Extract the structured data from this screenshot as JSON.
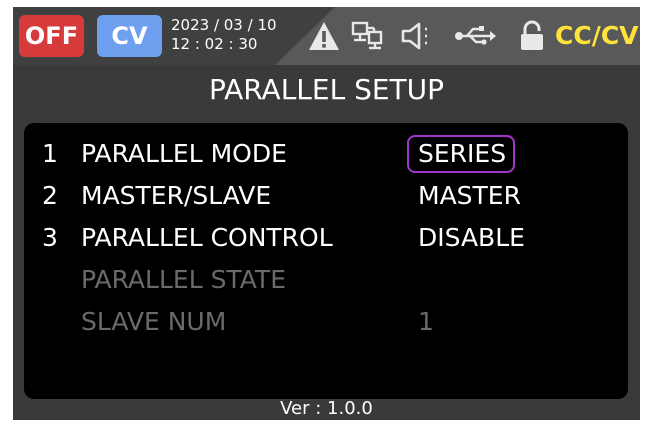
{
  "status": {
    "output_state": "OFF",
    "output_state_color": "#d63a3a",
    "regulation_mode": "CV",
    "regulation_mode_color": "#6fa0f0",
    "date": "2023 / 03 / 10",
    "time": "12 : 02 : 30",
    "icons": [
      "warning-icon",
      "network-icon",
      "speaker-icon",
      "usb-icon",
      "lock-icon"
    ],
    "priority_mode": "CC/CV",
    "priority_mode_color": "#ffe23a"
  },
  "page": {
    "title": "PARALLEL SETUP"
  },
  "settings": [
    {
      "number": "1",
      "label": "PARALLEL MODE",
      "value": "SERIES",
      "selected": true,
      "enabled": true
    },
    {
      "number": "2",
      "label": "MASTER/SLAVE",
      "value": "MASTER",
      "selected": false,
      "enabled": true
    },
    {
      "number": "3",
      "label": "PARALLEL CONTROL",
      "value": "DISABLE",
      "selected": false,
      "enabled": true
    },
    {
      "number": "",
      "label": "PARALLEL STATE",
      "value": "",
      "selected": false,
      "enabled": false
    },
    {
      "number": "",
      "label": "SLAVE NUM",
      "value": "1",
      "selected": false,
      "enabled": false
    }
  ],
  "footer": {
    "version": "Ver :  1.0.0"
  },
  "colors": {
    "selection_border": "#a335c9",
    "disabled_text": "#6a6a6a"
  }
}
